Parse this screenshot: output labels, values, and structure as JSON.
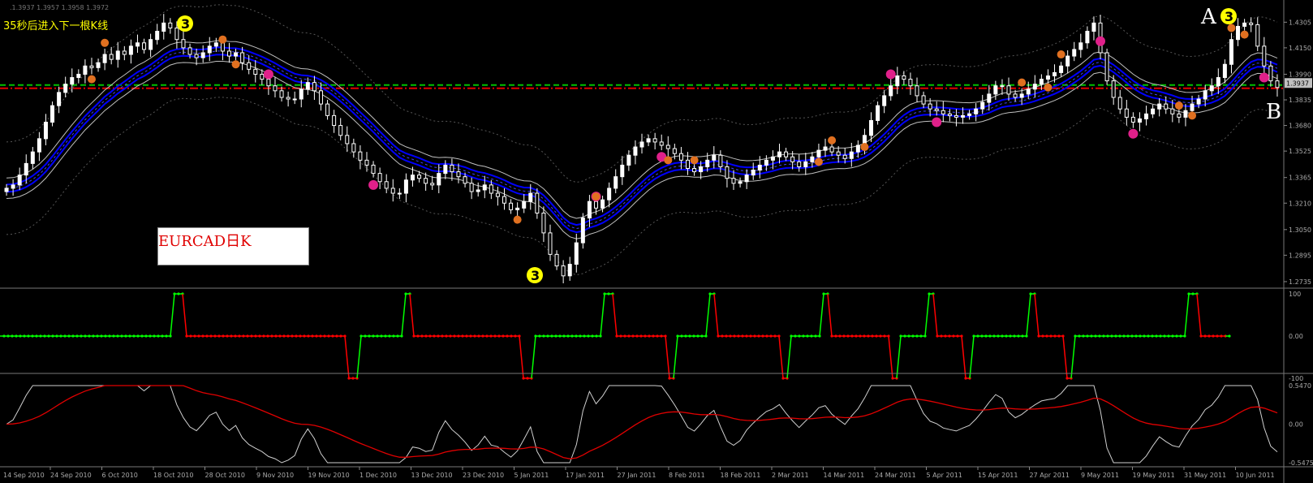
{
  "countdown_text": "35秒后进入下一根K线",
  "symbol_label": "EURCAD日K",
  "annotations": {
    "A": "A",
    "B": "B",
    "three": "3"
  },
  "top_info": ".1.3937 1.3957 1.3958 1.3972",
  "colors": {
    "bg": "#000000",
    "bull": "#ffffff",
    "bear": "#ffffff",
    "ema": "#0000ff",
    "band": "#c0c0c0",
    "green_line": "#00c000",
    "red_line": "#e00000",
    "osc_up": "#00ff00",
    "osc_down": "#ff0000",
    "fractal_orange": "#e07020",
    "fractal_magenta": "#e0208a",
    "three_badge": "#ffff00"
  },
  "chart_data": [
    {
      "type": "candlestick",
      "title": "EURCAD日K",
      "price_ticks": [
        "1.4305",
        "1.4150",
        "1.3990",
        "1.3835",
        "1.3680",
        "1.3525",
        "1.3365",
        "1.3210",
        "1.3050",
        "1.2895",
        "1.2735"
      ],
      "ylim": [
        1.272,
        1.44
      ],
      "current_price_label": "1.3937",
      "horizontal_lines": [
        {
          "color": "green",
          "style": "dashed",
          "value": 1.3925
        },
        {
          "color": "red",
          "style": "dashdot",
          "value": 1.3905
        }
      ],
      "x_labels": [
        "24 Sep 2010",
        "6 Oct 2010",
        "18 Oct 2010",
        "28 Oct 2010",
        "9 Nov 2010",
        "19 Nov 2010",
        "1 Dec 2010",
        "13 Dec 2010",
        "23 Dec 2010",
        "5 Jan 2011",
        "17 Jan 2011",
        "27 Jan 2011",
        "8 Feb 2011",
        "18 Feb 2011",
        "2 Mar 2011",
        "14 Mar 2011",
        "24 Mar 2011",
        "5 Apr 2011",
        "15 Apr 2011",
        "27 Apr 2011",
        "9 May 2011",
        "19 May 2011",
        "31 May 2011",
        "10 Jun 2011"
      ],
      "x_label_first": "14 Sep 2010",
      "close": [
        1.33,
        1.332,
        1.338,
        1.345,
        1.352,
        1.36,
        1.37,
        1.38,
        1.388,
        1.393,
        1.397,
        1.399,
        1.404,
        1.403,
        1.406,
        1.411,
        1.408,
        1.413,
        1.411,
        1.416,
        1.418,
        1.414,
        1.42,
        1.425,
        1.43,
        1.427,
        1.42,
        1.415,
        1.411,
        1.409,
        1.412,
        1.416,
        1.418,
        1.413,
        1.41,
        1.412,
        1.406,
        1.402,
        1.399,
        1.396,
        1.392,
        1.389,
        1.385,
        1.384,
        1.384,
        1.39,
        1.394,
        1.389,
        1.381,
        1.374,
        1.368,
        1.362,
        1.357,
        1.352,
        1.347,
        1.344,
        1.339,
        1.334,
        1.33,
        1.327,
        1.327,
        1.335,
        1.338,
        1.336,
        1.333,
        1.332,
        1.339,
        1.344,
        1.34,
        1.337,
        1.333,
        1.328,
        1.329,
        1.332,
        1.327,
        1.325,
        1.321,
        1.317,
        1.318,
        1.322,
        1.327,
        1.315,
        1.303,
        1.29,
        1.283,
        1.277,
        1.284,
        1.297,
        1.312,
        1.322,
        1.318,
        1.323,
        1.33,
        1.337,
        1.344,
        1.35,
        1.355,
        1.358,
        1.36,
        1.358,
        1.356,
        1.354,
        1.351,
        1.347,
        1.342,
        1.34,
        1.343,
        1.347,
        1.35,
        1.343,
        1.336,
        1.333,
        1.334,
        1.338,
        1.341,
        1.344,
        1.347,
        1.349,
        1.352,
        1.349,
        1.346,
        1.343,
        1.346,
        1.349,
        1.353,
        1.355,
        1.352,
        1.35,
        1.348,
        1.352,
        1.356,
        1.362,
        1.371,
        1.38,
        1.386,
        1.392,
        1.398,
        1.396,
        1.392,
        1.386,
        1.381,
        1.378,
        1.377,
        1.375,
        1.374,
        1.373,
        1.374,
        1.375,
        1.378,
        1.382,
        1.387,
        1.392,
        1.392,
        1.387,
        1.385,
        1.387,
        1.39,
        1.393,
        1.396,
        1.398,
        1.4,
        1.404,
        1.41,
        1.414,
        1.418,
        1.425,
        1.43,
        1.412,
        1.395,
        1.385,
        1.378,
        1.373,
        1.37,
        1.372,
        1.375,
        1.378,
        1.381,
        1.378,
        1.375,
        1.373,
        1.377,
        1.381,
        1.384,
        1.389,
        1.392,
        1.397,
        1.405,
        1.42,
        1.428,
        1.43,
        1.429,
        1.416,
        1.404,
        1.395,
        1.391
      ]
    },
    {
      "type": "line",
      "title": "",
      "ylim": [
        -100,
        100
      ],
      "y_ticks": [
        "100",
        "0.00",
        "-100"
      ],
      "levels": [
        100,
        0,
        -100
      ]
    },
    {
      "type": "line",
      "title": "",
      "y_ticks": [
        "0.5470",
        "0.00",
        "-0.5475"
      ],
      "ylim": [
        -0.5475,
        0.547
      ]
    }
  ]
}
